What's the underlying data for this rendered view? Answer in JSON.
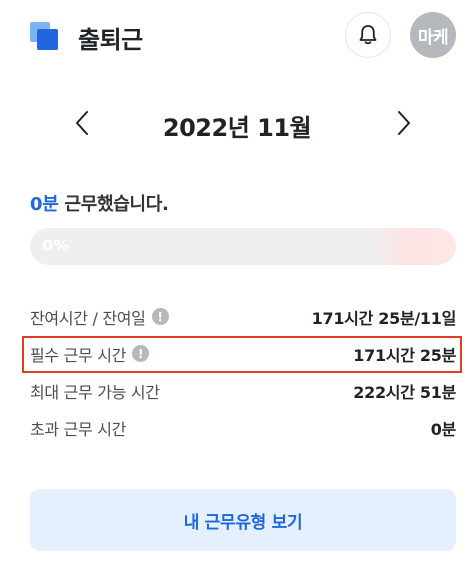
{
  "header": {
    "app_title": "출퇴근",
    "avatar_text": "마케"
  },
  "month_nav": {
    "title": "2022년 11월"
  },
  "summary": {
    "worked_value": "0분",
    "worked_suffix": " 근무했습니다.",
    "progress_label": "0%",
    "progress_percent": 0
  },
  "rows": [
    {
      "label": "잔여시간 / 잔여일",
      "value": "171시간 25분/11일",
      "info": true
    },
    {
      "label": "필수 근무 시간",
      "value": "171시간 25분",
      "info": true
    },
    {
      "label": "최대 근무 가능 시간",
      "value": "222시간 51분",
      "info": false
    },
    {
      "label": "초과 근무 시간",
      "value": "0분",
      "info": false
    }
  ],
  "cta": {
    "label": "내 근무유형 보기"
  },
  "colors": {
    "accent": "#1f66e0",
    "highlight": "#e43c1e",
    "cta_bg": "#e5f0ff"
  }
}
